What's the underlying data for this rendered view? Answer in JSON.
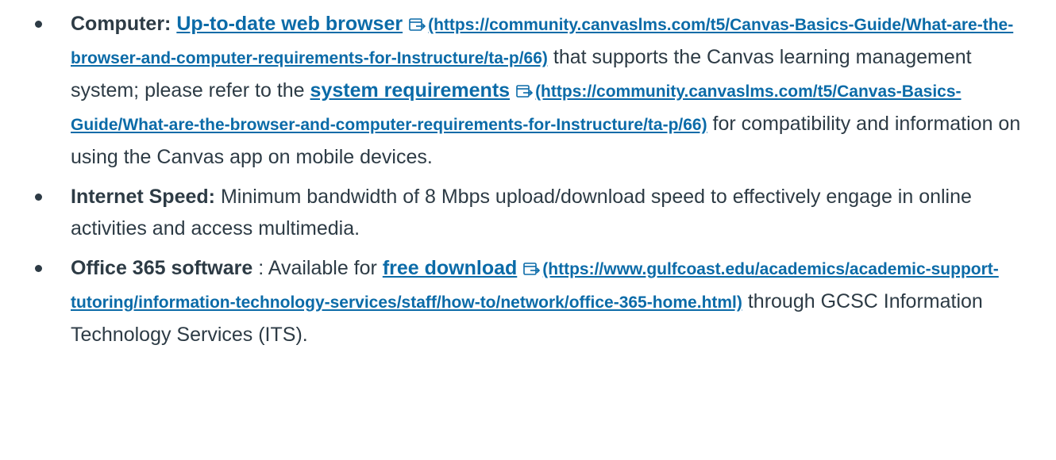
{
  "items": [
    {
      "label": "Computer:",
      "link_text": "Up-to-date web browser",
      "link_url": "(https://community.canvaslms.com/t5/Canvas-Basics-Guide/What-are-the-browser-and-computer-requirements-for-Instructure/ta-p/66)",
      "text_after": "that supports the Canvas learning management system; please refer to the",
      "link2_text": "system requirements",
      "link2_url": "(https://community.canvaslms.com/t5/Canvas-Basics-Guide/What-are-the-browser-and-computer-requirements-for-Instructure/ta-p/66)",
      "text_end": "for compatibility and information on using the Canvas app on mobile devices."
    },
    {
      "label": "Internet Speed:",
      "text": " Minimum bandwidth of 8 Mbps upload/download speed to effectively engage in online activities and access multimedia."
    },
    {
      "label": "Office 365 software",
      "text_before": " : Available for",
      "link_text": "free download",
      "link_url": "(https://www.gulfcoast.edu/academics/academic-support-tutoring/information-technology-services/staff/how-to/network/office-365-home.html)",
      "text_end": "through GCSC Information Technology Services (ITS)."
    }
  ],
  "colors": {
    "text": "#2d3b45",
    "link": "#0b6ba8"
  },
  "icons": {
    "external_link": "external-link-icon"
  }
}
